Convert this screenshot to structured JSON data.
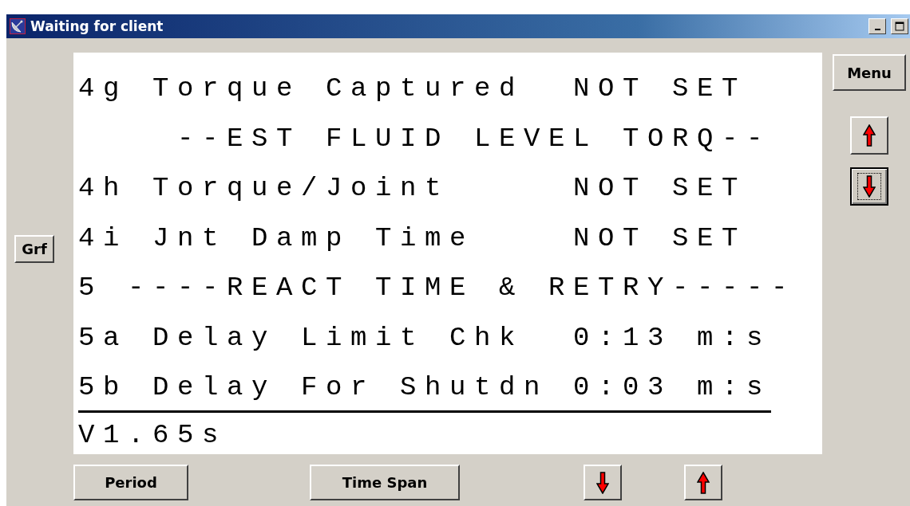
{
  "window": {
    "title": "Waiting for client"
  },
  "side_button": {
    "label": "Grf"
  },
  "menu_button": {
    "label": "Menu"
  },
  "scroll_buttons": [
    {
      "kind": "up",
      "focused": false
    },
    {
      "kind": "down",
      "focused": true
    }
  ],
  "display_lines": [
    {
      "text": "4g Torque Captured  NOT SET",
      "selected": false
    },
    {
      "text": "    --EST FLUID LEVEL TORQ--",
      "selected": false
    },
    {
      "text": "4h Torque/Joint     NOT SET",
      "selected": false
    },
    {
      "text": "4i Jnt Damp Time    NOT SET",
      "selected": false
    },
    {
      "text": "5 ----REACT TIME & RETRY-----",
      "selected": false
    },
    {
      "text": "5a Delay Limit Chk  0:13 m:s",
      "selected": false
    },
    {
      "text": "5b Delay For Shutdn 0:03 m:s",
      "selected": true
    },
    {
      "text": "V1.65s",
      "selected": false
    }
  ],
  "bottom_buttons": [
    {
      "kind": "text",
      "label": "Period"
    },
    {
      "kind": "text",
      "label": "Time Span"
    },
    {
      "kind": "down"
    },
    {
      "kind": "up"
    }
  ]
}
